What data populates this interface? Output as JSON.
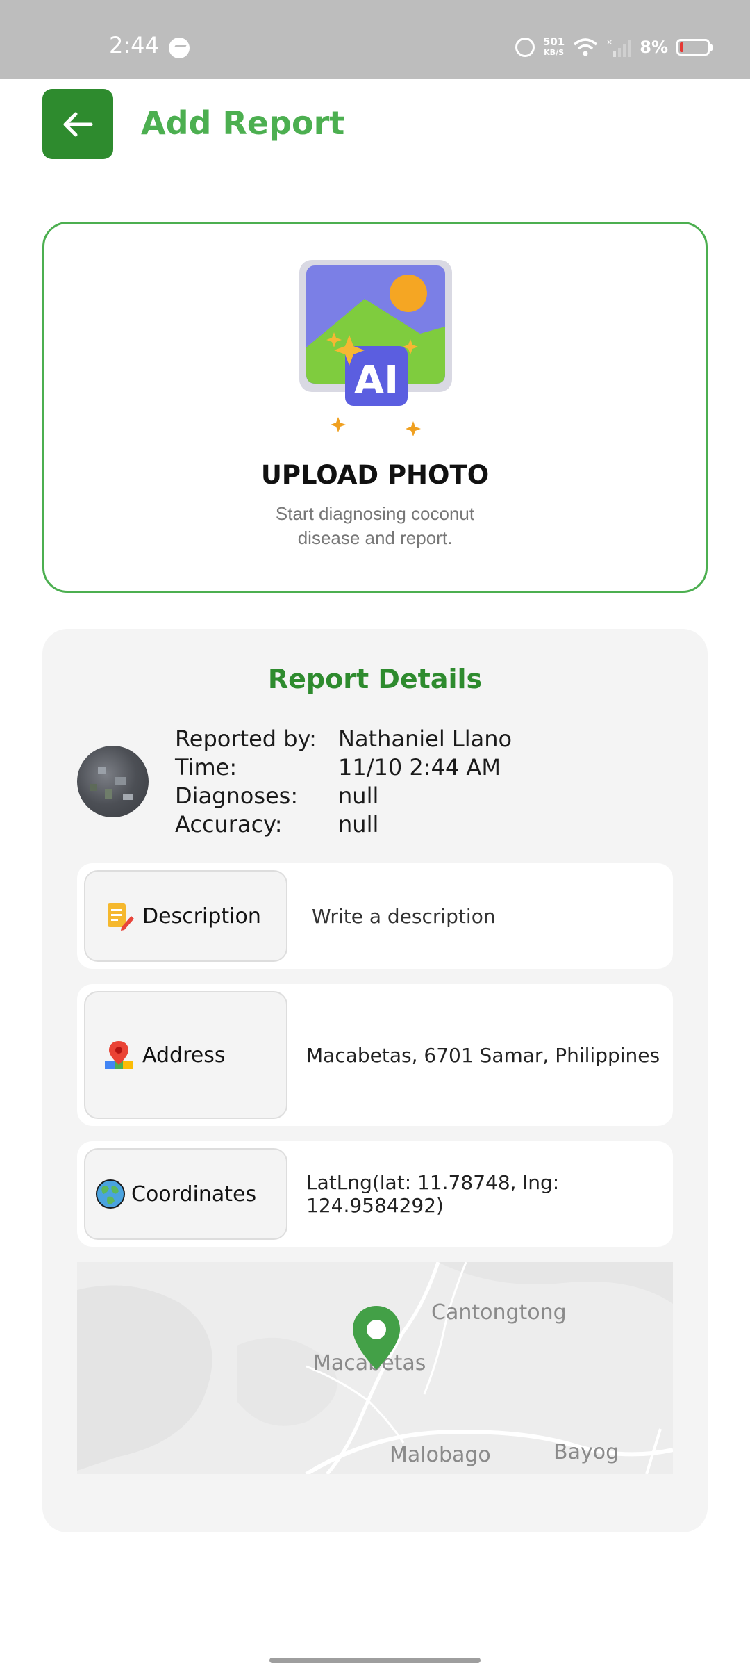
{
  "status_bar": {
    "time": "2:44",
    "network_speed_value": "501",
    "network_speed_unit": "KB/S",
    "battery_percent": "8%",
    "icons": [
      "messenger-icon",
      "alarm-icon",
      "wifi-icon",
      "signal-icon",
      "battery-icon"
    ]
  },
  "header": {
    "title": "Add Report",
    "back_icon": "arrow-left-icon",
    "accent_color": "#4caf50",
    "button_color": "#2e8b2e"
  },
  "upload": {
    "title": "UPLOAD PHOTO",
    "subtitle_line1": "Start diagnosing coconut",
    "subtitle_line2": "disease and report.",
    "illustration_badge": "AI",
    "illustration_icon": "ai-image-icon"
  },
  "report_details": {
    "title": "Report Details",
    "info": [
      {
        "label": "Reported by:",
        "value": "Nathaniel Llano"
      },
      {
        "label": "Time:",
        "value": "11/10 2:44 AM"
      },
      {
        "label": "Diagnoses:",
        "value": "null"
      },
      {
        "label": "Accuracy:",
        "value": "null"
      }
    ],
    "fields": {
      "description": {
        "label": "Description",
        "placeholder": "Write a description",
        "icon": "notepad-pencil-icon"
      },
      "address": {
        "label": "Address",
        "value": "Macabetas, 6701 Samar, Philippines",
        "icon": "map-pin-icon"
      },
      "coordinates": {
        "label": "Coordinates",
        "value": "LatLng(lat: 11.78748, lng: 124.9584292)",
        "icon": "globe-icon"
      }
    },
    "map": {
      "labels": [
        "Cantongtong",
        "Macabetas",
        "Malobago",
        "Bayog"
      ],
      "marker_icon": "location-marker-icon"
    }
  }
}
